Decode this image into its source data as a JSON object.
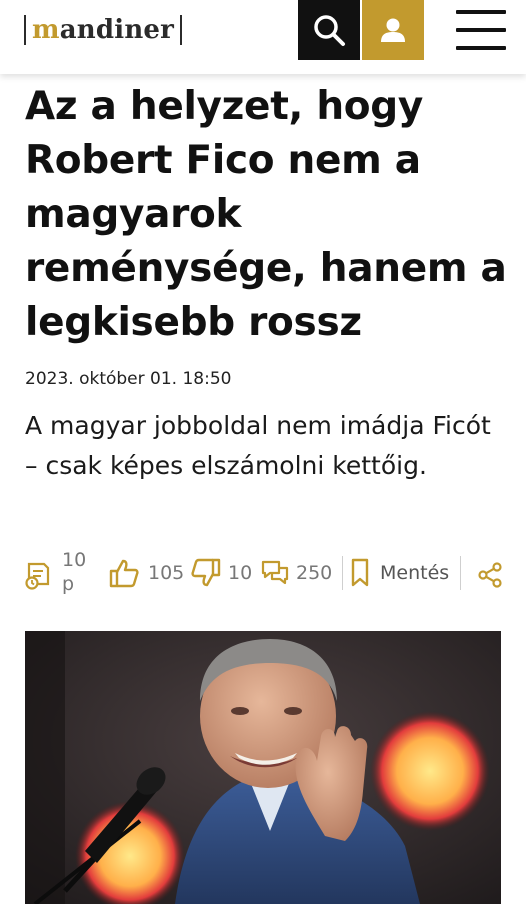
{
  "header": {
    "logo_text": "mandiner",
    "logo_first_letter": "m",
    "logo_rest": "andiner",
    "accent_color": "#c29a2e",
    "search_icon": "search-icon",
    "user_icon": "user-icon",
    "menu_icon": "hamburger-menu-icon"
  },
  "article": {
    "title": "Az a helyzet, hogy Robert Fico nem a magyarok reménysége, hanem a legkisebb rossz",
    "date": "2023. október 01. 18:50",
    "lead": "A magyar jobboldal nem imádja Ficót – csak képes elszámolni kettőig."
  },
  "meta": {
    "reading_time_value": "10",
    "reading_time_unit": "p",
    "likes": "105",
    "dislikes": "10",
    "comments": "250",
    "save_label": "Mentés"
  }
}
